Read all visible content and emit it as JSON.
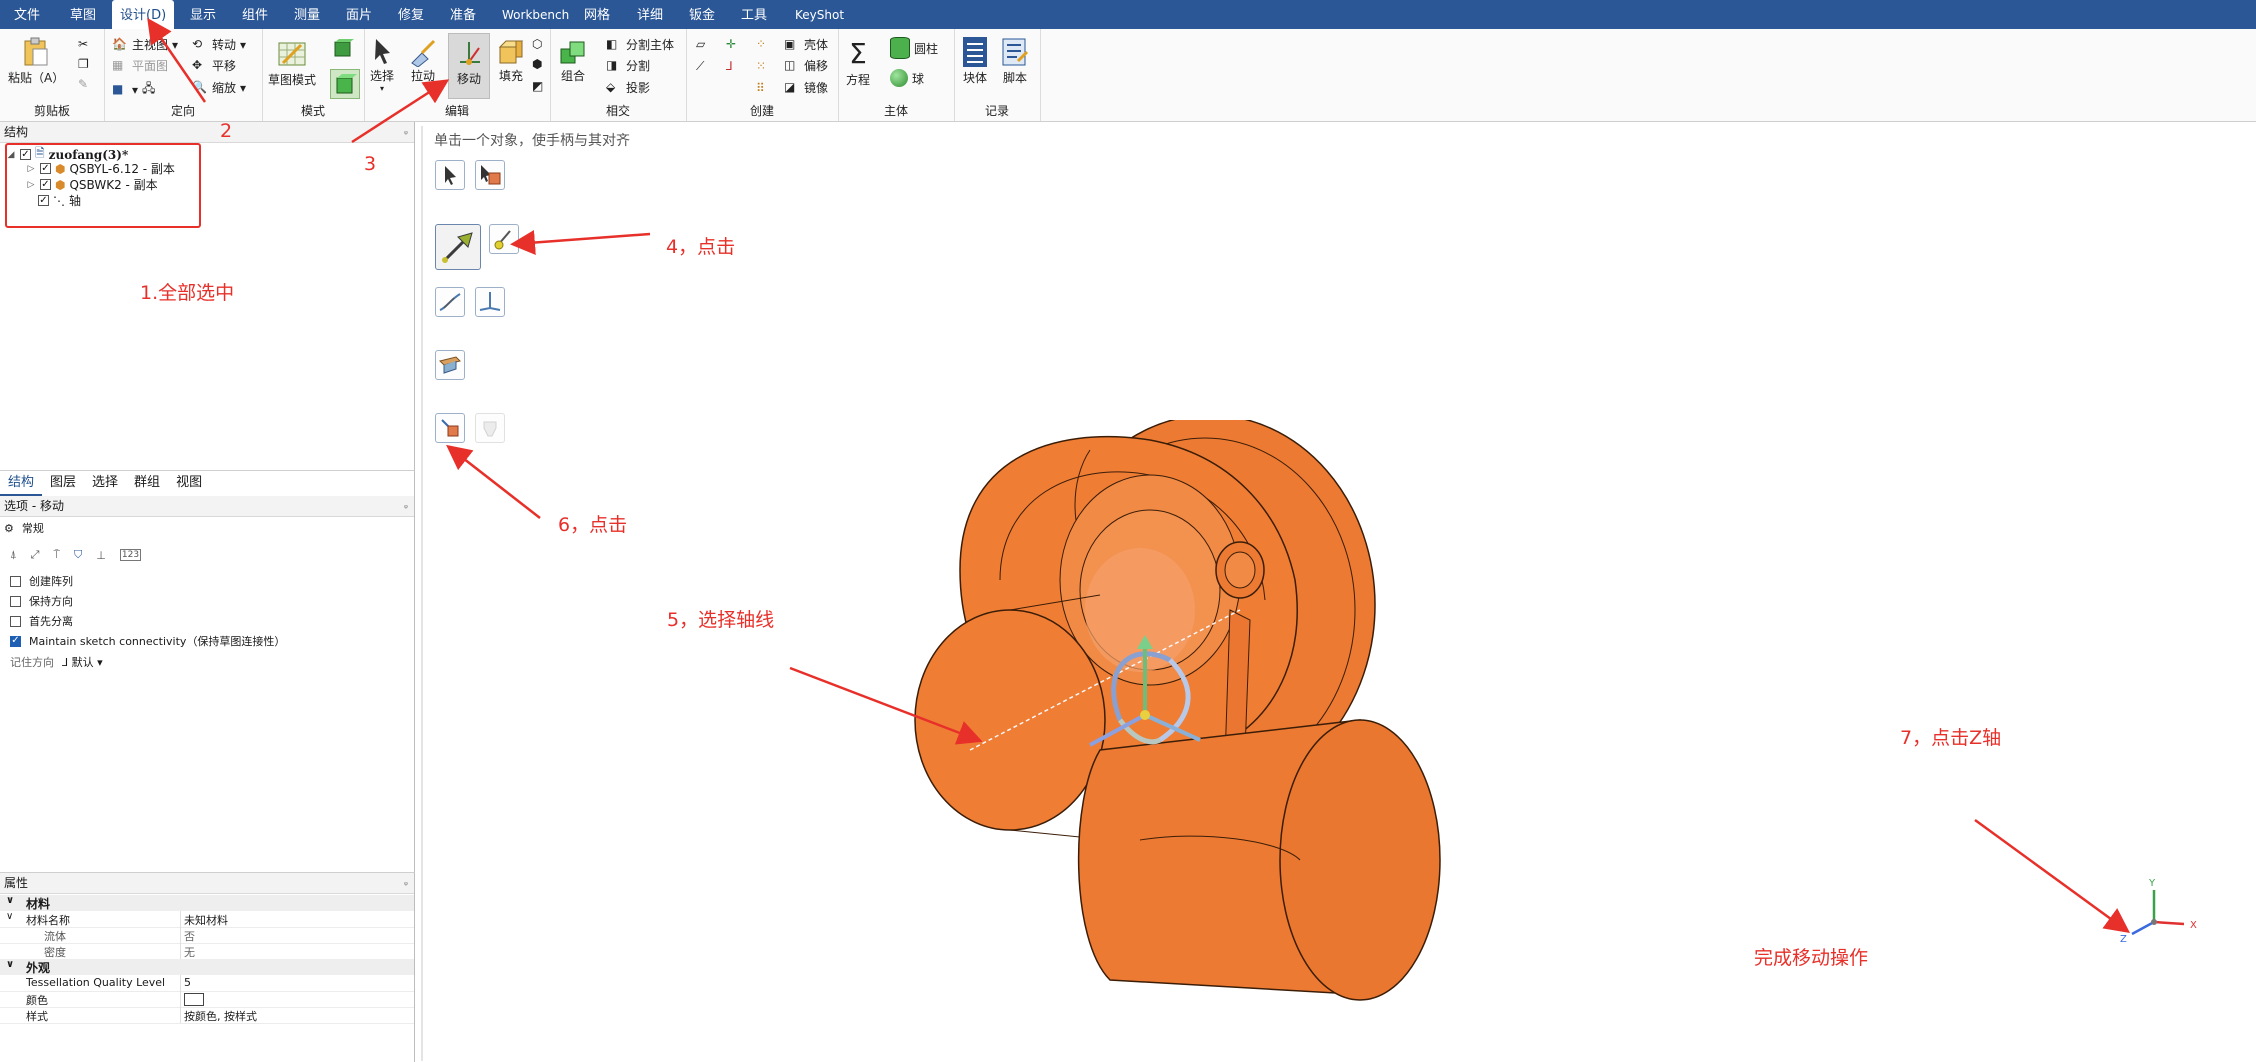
{
  "menu": {
    "tabs": [
      "文件",
      "草图",
      "设计(D)",
      "显示",
      "组件",
      "测量",
      "面片",
      "修复",
      "准备",
      "Workbench",
      "网格",
      "详细",
      "钣金",
      "工具",
      "KeyShot"
    ],
    "active": "设计(D)"
  },
  "ribbon": {
    "clipboard": {
      "paste_label": "粘贴（A）",
      "group_label": "剪贴板"
    },
    "orient": {
      "home_label": "主视图",
      "plane_label": "平面图",
      "rotate_label": "转动",
      "pan_label": "平移",
      "zoom_label": "缩放",
      "group_label": "定向"
    },
    "mode": {
      "sketch_label": "草图模式",
      "group_label": "模式"
    },
    "edit": {
      "select_label": "选择",
      "pull_label": "拉动",
      "move_label": "移动",
      "fill_label": "填充",
      "group_label": "编辑"
    },
    "intersect": {
      "combine_label": "组合",
      "split_body_label": "分割主体",
      "split_label": "分割",
      "project_label": "投影",
      "group_label": "相交"
    },
    "create": {
      "shell_label": "壳体",
      "offset_label": "偏移",
      "mirror_label": "镜像",
      "group_label": "创建"
    },
    "body": {
      "equation_label": "方程",
      "cylinder_label": "圆柱",
      "sphere_label": "球",
      "group_label": "主体"
    },
    "record": {
      "block_label": "块体",
      "script_label": "脚本",
      "group_label": "记录"
    }
  },
  "structure": {
    "title": "结构",
    "root": "zuofang(3)*",
    "children": [
      "QSBYL-6.12 - 副本",
      "QSBWK2 - 副本",
      "轴"
    ]
  },
  "tabs": [
    "结构",
    "图层",
    "选择",
    "群组",
    "视图"
  ],
  "options": {
    "title": "选项 - 移动",
    "section": "常规",
    "checks": [
      {
        "label": "创建阵列",
        "checked": false
      },
      {
        "label": "保持方向",
        "checked": false
      },
      {
        "label": "首先分离",
        "checked": false
      },
      {
        "label": "Maintain sketch connectivity（保持草图连接性）",
        "checked": true
      }
    ],
    "orient_label": "记住方向",
    "orient_value": "默认"
  },
  "properties": {
    "title": "属性",
    "material_cat": "材料",
    "material_name_k": "材料名称",
    "material_name_v": "未知材料",
    "fluid_k": "流体",
    "fluid_v": "否",
    "density_k": "密度",
    "density_v": "无",
    "appearance_cat": "外观",
    "tess_k": "Tessellation Quality Level",
    "tess_v": "5",
    "color_k": "颜色",
    "style_k": "样式",
    "style_v": "按颜色, 按样式"
  },
  "viewport": {
    "hint": "单击一个对象，使手柄与其对齐",
    "triad": {
      "x": "X",
      "y": "Y",
      "z": "Z"
    }
  },
  "annotations": {
    "a1": "1.全部选中",
    "a2": "2",
    "a3": "3",
    "a4": "4，点击",
    "a5": "5，选择轴线",
    "a6": "6，点击",
    "a7": "7，点击Z轴",
    "done": "完成移动操作"
  },
  "colors": {
    "accent": "#2b5797",
    "model": "#ef7d34",
    "annotation": "#e8302a"
  }
}
